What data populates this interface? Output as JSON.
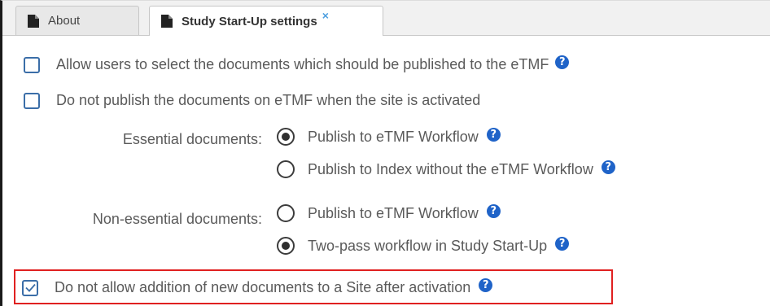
{
  "tabs": [
    {
      "label": "About",
      "icon": "document-icon",
      "active": false
    },
    {
      "label": "Study Start-Up settings",
      "icon": "document-icon",
      "active": true,
      "close_glyph": "×"
    }
  ],
  "settings": {
    "allow_select_docs": {
      "label": "Allow users to select the documents which should be published to the eTMF",
      "checked": false
    },
    "do_not_publish": {
      "label": "Do not publish the documents on eTMF when the site is activated",
      "checked": false
    },
    "essential": {
      "label": "Essential documents:",
      "options": [
        {
          "label": "Publish to eTMF Workflow",
          "selected": true
        },
        {
          "label": "Publish to Index without the eTMF Workflow",
          "selected": false
        }
      ]
    },
    "non_essential": {
      "label": "Non-essential documents:",
      "options": [
        {
          "label": "Publish to eTMF Workflow",
          "selected": false
        },
        {
          "label": "Two-pass workflow in Study Start-Up",
          "selected": true
        }
      ]
    },
    "no_new_docs": {
      "label": "Do not allow addition of new documents to a Site after activation",
      "checked": true
    }
  },
  "help_glyph": "?",
  "colors": {
    "accent": "#1f63c8",
    "checkbox_border": "#3b6ea8",
    "highlight": "#e02020",
    "close": "#4d9fe0"
  }
}
